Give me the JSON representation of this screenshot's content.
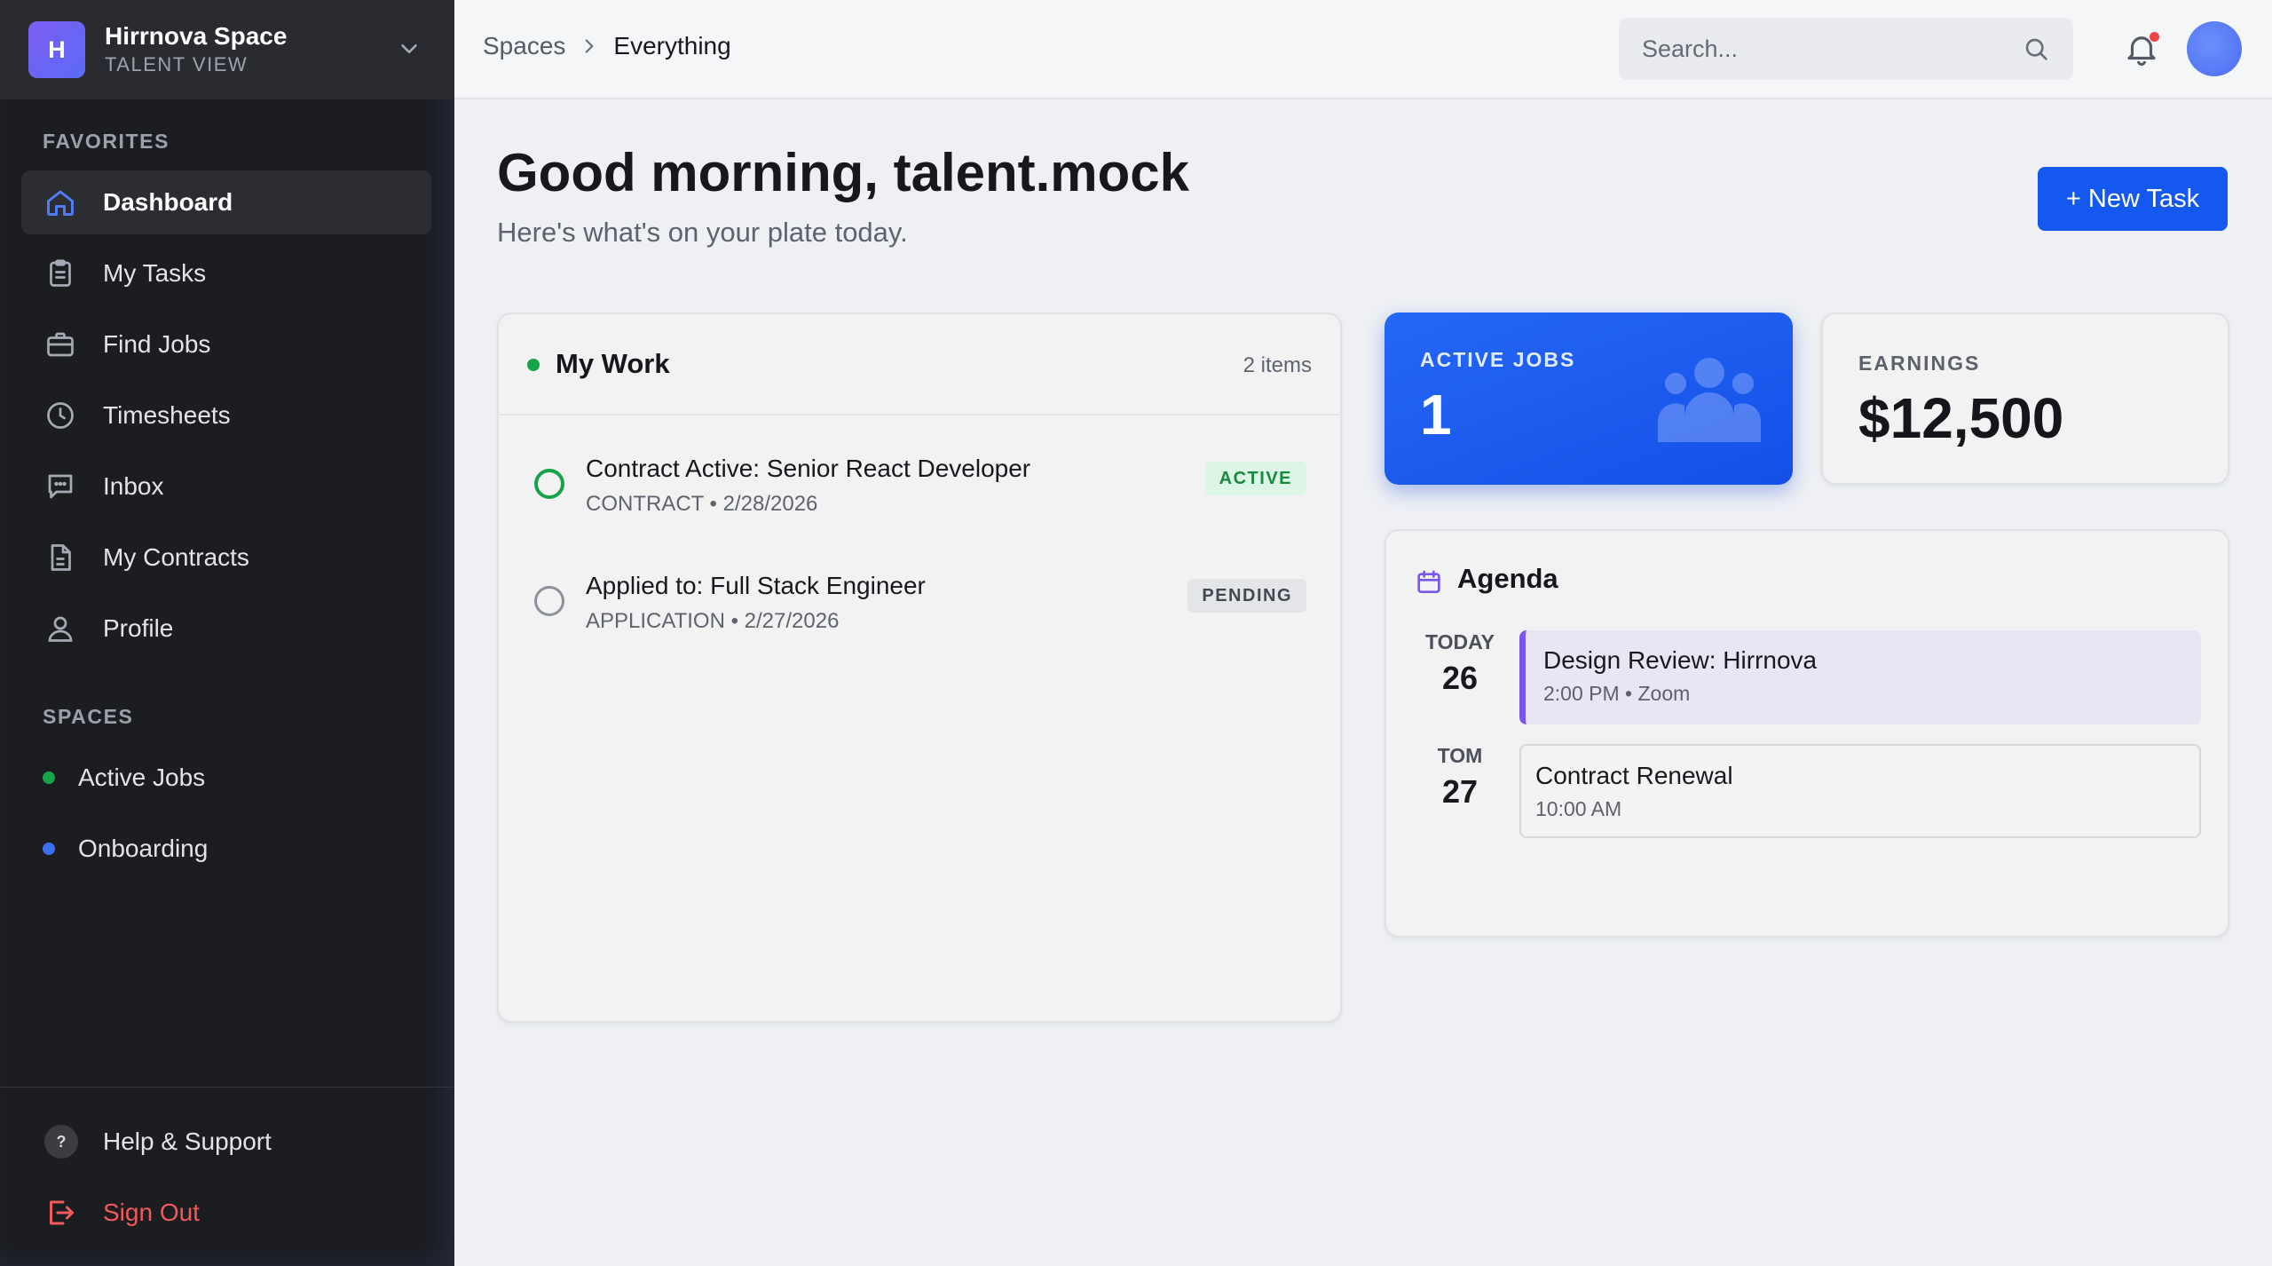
{
  "workspace": {
    "initial": "H",
    "name": "Hirrnova Space",
    "subtitle": "TALENT VIEW"
  },
  "sidebar": {
    "favorites_label": "FAVORITES",
    "items": [
      {
        "label": "Dashboard",
        "icon": "home-icon",
        "active": true
      },
      {
        "label": "My Tasks",
        "icon": "clipboard-icon"
      },
      {
        "label": "Find Jobs",
        "icon": "briefcase-icon"
      },
      {
        "label": "Timesheets",
        "icon": "clock-icon"
      },
      {
        "label": "Inbox",
        "icon": "message-icon"
      },
      {
        "label": "My Contracts",
        "icon": "document-icon"
      },
      {
        "label": "Profile",
        "icon": "user-icon"
      }
    ],
    "spaces_label": "SPACES",
    "spaces": [
      {
        "label": "Active Jobs",
        "color": "#16a34a"
      },
      {
        "label": "Onboarding",
        "color": "#3b6ff2"
      }
    ],
    "help": {
      "label": "Help & Support",
      "glyph": "?"
    },
    "signout": {
      "label": "Sign Out"
    }
  },
  "topbar": {
    "breadcrumb": {
      "parent": "Spaces",
      "current": "Everything"
    },
    "search_placeholder": "Search..."
  },
  "header": {
    "greeting": "Good morning, talent.mock",
    "subtitle": "Here's what's on your plate today.",
    "new_task_label": "+ New Task"
  },
  "my_work": {
    "title": "My Work",
    "count": "2 items",
    "tasks": [
      {
        "title": "Contract Active: Senior React Developer",
        "meta": "CONTRACT • 2/28/2026",
        "status": "ACTIVE"
      },
      {
        "title": "Applied to: Full Stack Engineer",
        "meta": "APPLICATION • 2/27/2026",
        "status": "PENDING"
      }
    ]
  },
  "stats": {
    "active_jobs": {
      "label": "ACTIVE JOBS",
      "value": "1"
    },
    "earnings": {
      "label": "EARNINGS",
      "value": "$12,500"
    }
  },
  "agenda": {
    "title": "Agenda",
    "days": [
      {
        "dow": "TODAY",
        "num": "26",
        "event_title": "Design Review: Hirrnova",
        "event_meta": "2:00 PM • Zoom"
      },
      {
        "dow": "TOM",
        "num": "27",
        "event_title": "Contract Renewal",
        "event_meta": "10:00 AM"
      }
    ]
  },
  "colors": {
    "accent": "#1558f0",
    "sidebar_bg": "#1c1d21",
    "active_green": "#16a34a",
    "danger": "#f05a5a",
    "agenda_purple": "#7c55ec"
  }
}
